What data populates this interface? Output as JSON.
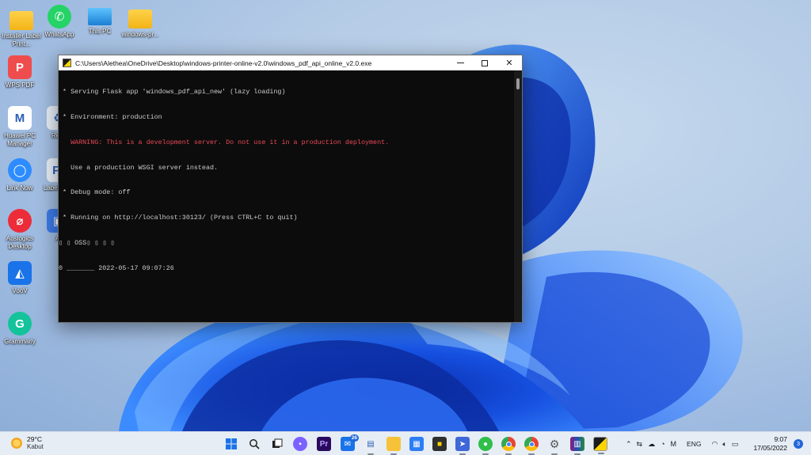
{
  "desktop": {
    "icons": [
      {
        "label": "Installer Label Print...",
        "icon": "folder-icon"
      },
      {
        "label": "WhatsApp",
        "icon": "whatsapp-icon"
      },
      {
        "label": "This PC",
        "icon": "computer-icon"
      },
      {
        "label": "windows-pr...",
        "icon": "folder-icon"
      },
      {
        "label": "WPS PDF",
        "icon": "wps-pdf-icon"
      },
      {
        "label": "Huawei PC Manager",
        "icon": "huawei-icon"
      },
      {
        "label": "Link Now",
        "icon": "link-now-icon"
      },
      {
        "label": "Auslogics Desktop",
        "icon": "auslogics-icon"
      },
      {
        "label": "VooV",
        "icon": "voov-icon"
      },
      {
        "label": "Grammarly",
        "icon": "grammarly-icon"
      },
      {
        "label": "Recy",
        "icon": "recycle-bin-icon"
      },
      {
        "label": "Label Setu",
        "icon": "label-setup-icon"
      },
      {
        "label": "Ar",
        "icon": "app-icon"
      }
    ]
  },
  "console": {
    "title": "C:\\Users\\Alethea\\OneDrive\\Desktop\\windows-printer-online-v2.0\\windows_pdf_api_online_v2.0.exe",
    "lines": [
      " * Serving Flask app 'windows_pdf_api_new' (lazy loading)",
      " * Environment: production",
      "   WARNING: This is a development server. Do not use it in a production deployment.",
      "   Use a production WSGI server instead.",
      " * Debug mode: off",
      " * Running on http://localhost:30123/ (Press CTRL+C to quit)",
      "▯ ▯ OSS▯ ▯ ▯ ▯",
      "0 _______ 2022-05-17 09:07:26"
    ],
    "warning_color": "#e74856",
    "text_color": "#cccccc"
  },
  "taskbar": {
    "weather": {
      "temp": "29°C",
      "condition": "Kabut"
    },
    "apps": [
      {
        "name": "start-button",
        "icon": "windows-logo-icon"
      },
      {
        "name": "search-button",
        "icon": "search-icon"
      },
      {
        "name": "task-view-button",
        "icon": "task-view-icon"
      },
      {
        "name": "chat-button",
        "icon": "chat-icon"
      },
      {
        "name": "premiere-button",
        "icon": "premiere-icon",
        "label": "Pr"
      },
      {
        "name": "mail-button",
        "icon": "mail-icon",
        "badge": "26"
      },
      {
        "name": "notepad-button",
        "icon": "notepad-icon"
      },
      {
        "name": "explorer-button",
        "icon": "folder-icon"
      },
      {
        "name": "store-button",
        "icon": "store-icon"
      },
      {
        "name": "sticky-button",
        "icon": "sticky-notes-icon"
      },
      {
        "name": "teams-button",
        "icon": "teams-icon"
      },
      {
        "name": "wechat-button",
        "icon": "wechat-icon"
      },
      {
        "name": "chrome-a-button",
        "icon": "chrome-icon"
      },
      {
        "name": "chrome-b-button",
        "icon": "chrome-icon"
      },
      {
        "name": "settings-button",
        "icon": "gear-icon"
      },
      {
        "name": "winrar-button",
        "icon": "winrar-icon"
      },
      {
        "name": "console-button",
        "icon": "console-icon"
      }
    ],
    "tray": {
      "language": "ENG"
    },
    "clock": {
      "time": "9:07",
      "date": "17/05/2022"
    },
    "notifications": "3"
  }
}
